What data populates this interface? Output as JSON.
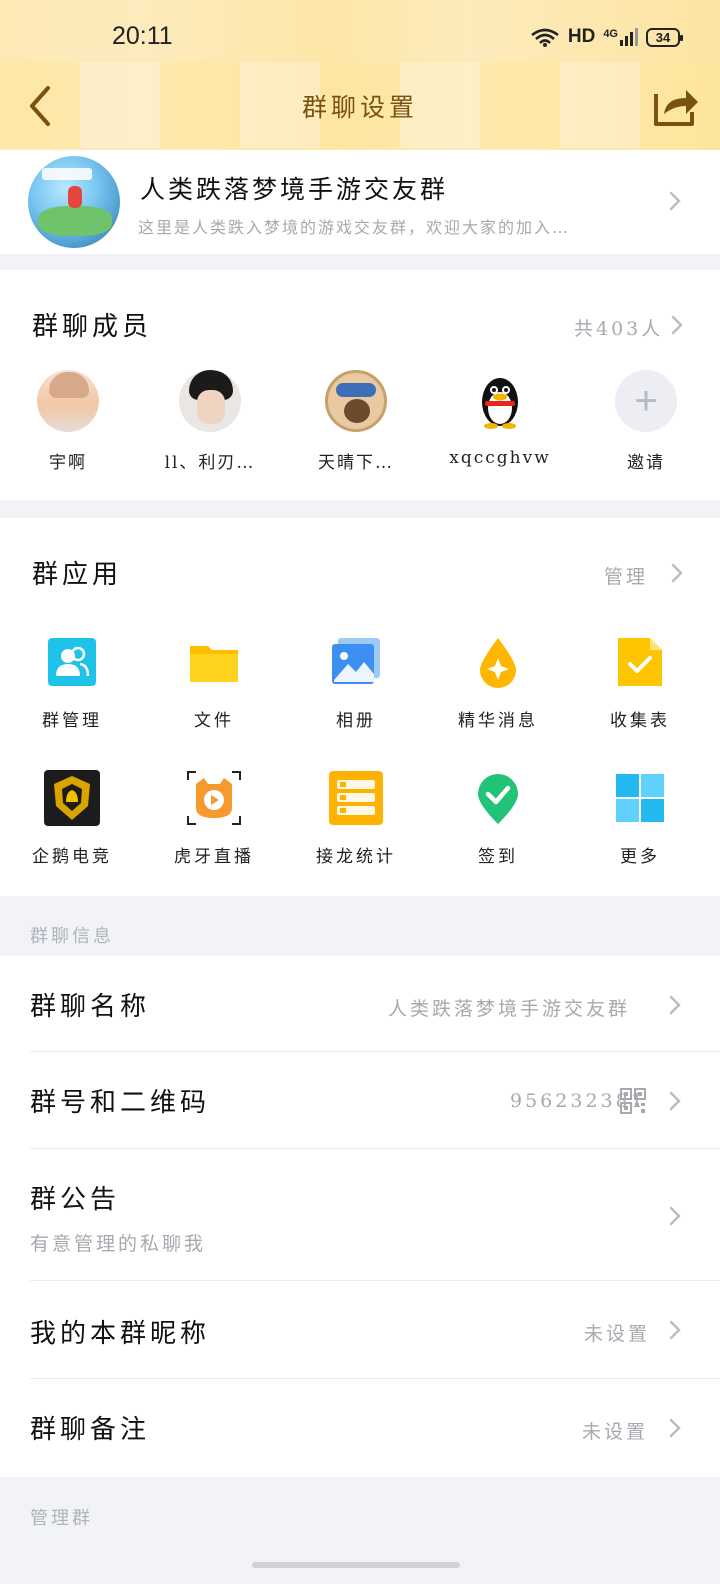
{
  "status_bar": {
    "time": "20:11",
    "hd": "HD",
    "network": "4G",
    "battery": "34"
  },
  "header": {
    "title": "群聊设置"
  },
  "group": {
    "name": "人类跌落梦境手游交友群",
    "description": "这里是人类跌入梦境的游戏交友群，欢迎大家的加入…"
  },
  "members": {
    "title": "群聊成员",
    "count": "共403人",
    "list": [
      {
        "name": "宇啊"
      },
      {
        "name": "ll、利刃…"
      },
      {
        "name": "天晴下…"
      },
      {
        "name": "xqccghvw"
      },
      {
        "name": "邀请"
      }
    ]
  },
  "apps": {
    "title": "群应用",
    "manage": "管理",
    "items": [
      {
        "label": "群管理",
        "icon": "group-manage-icon"
      },
      {
        "label": "文件",
        "icon": "folder-icon"
      },
      {
        "label": "相册",
        "icon": "album-icon"
      },
      {
        "label": "精华消息",
        "icon": "essence-icon"
      },
      {
        "label": "收集表",
        "icon": "form-icon"
      },
      {
        "label": "企鹅电竞",
        "icon": "esports-icon"
      },
      {
        "label": "虎牙直播",
        "icon": "huya-icon"
      },
      {
        "label": "接龙统计",
        "icon": "solitaire-icon"
      },
      {
        "label": "签到",
        "icon": "checkin-icon"
      },
      {
        "label": "更多",
        "icon": "more-apps-icon"
      }
    ]
  },
  "info": {
    "section_title": "群聊信息",
    "group_name": {
      "label": "群聊名称",
      "value": "人类跌落梦境手游交友群"
    },
    "group_number": {
      "label": "群号和二维码",
      "value": "956232381"
    },
    "announcement": {
      "label": "群公告",
      "value": "有意管理的私聊我"
    },
    "my_nickname": {
      "label": "我的本群昵称",
      "value": "未设置"
    },
    "remark": {
      "label": "群聊备注",
      "value": "未设置"
    }
  },
  "manage_section_title": "管理群",
  "colors": {
    "header_bg": "#fde9b6",
    "header_title": "#7a5210",
    "secondary_text": "#a8a8b0"
  }
}
